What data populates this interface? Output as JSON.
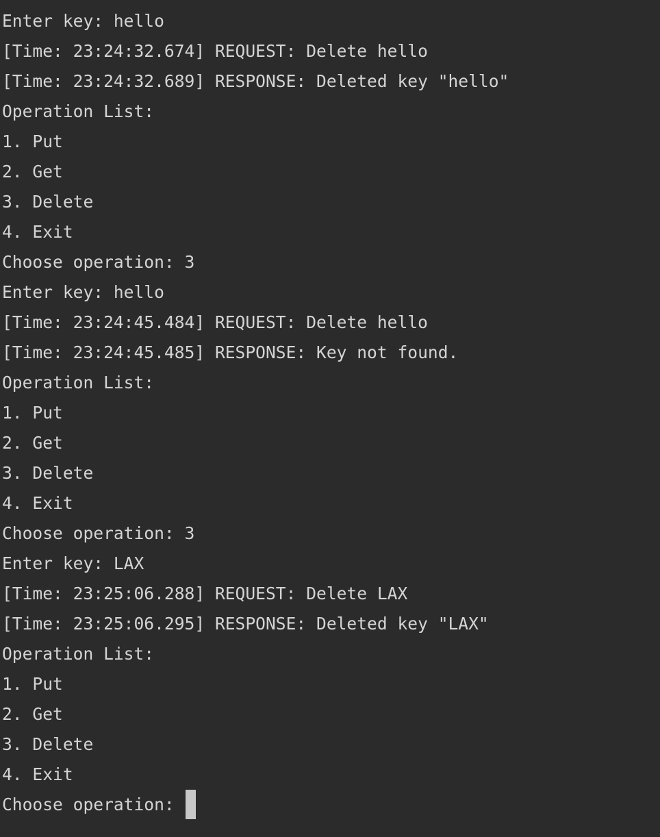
{
  "terminal": {
    "background": "#2b2b2b",
    "foreground": "#d4d4d4",
    "cursor_color": "#c8c8c8",
    "lines": [
      "Enter key: hello",
      "[Time: 23:24:32.674] REQUEST: Delete hello",
      "[Time: 23:24:32.689] RESPONSE: Deleted key \"hello\"",
      "Operation List:",
      "1. Put",
      "2. Get",
      "3. Delete",
      "4. Exit",
      "Choose operation: 3",
      "Enter key: hello",
      "[Time: 23:24:45.484] REQUEST: Delete hello",
      "[Time: 23:24:45.485] RESPONSE: Key not found.",
      "Operation List:",
      "1. Put",
      "2. Get",
      "3. Delete",
      "4. Exit",
      "Choose operation: 3",
      "Enter key: LAX",
      "[Time: 23:25:06.288] REQUEST: Delete LAX",
      "[Time: 23:25:06.295] RESPONSE: Deleted key \"LAX\"",
      "Operation List:",
      "1. Put",
      "2. Get",
      "3. Delete",
      "4. Exit"
    ],
    "prompt": "Choose operation: "
  }
}
